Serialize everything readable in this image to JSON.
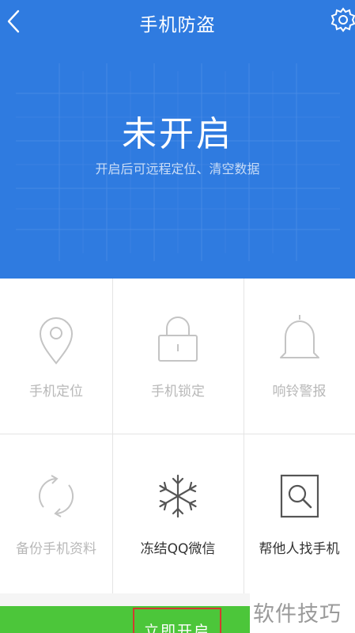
{
  "header": {
    "title": "手机防盗",
    "back_icon": "chevron-left-icon",
    "settings_icon": "gear-icon"
  },
  "status": {
    "text": "未开启",
    "description": "开启后可远程定位、清空数据"
  },
  "features": [
    {
      "label": "手机定位",
      "icon": "location-pin-icon",
      "enabled": false
    },
    {
      "label": "手机锁定",
      "icon": "lock-icon",
      "enabled": false
    },
    {
      "label": "响铃警报",
      "icon": "bell-icon",
      "enabled": false
    },
    {
      "label": "备份手机资料",
      "icon": "sync-icon",
      "enabled": false
    },
    {
      "label": "冻结QQ微信",
      "icon": "snowflake-icon",
      "enabled": true
    },
    {
      "label": "帮他人找手机",
      "icon": "search-frame-icon",
      "enabled": true
    }
  ],
  "action": {
    "open_label": "立即开启"
  },
  "watermark": {
    "text": "软件技巧"
  },
  "colors": {
    "header_blue": "#2f7be0",
    "button_green": "#4cc63a",
    "highlight_red": "#d23b2f",
    "disabled_gray": "#b8b8b8",
    "active_text": "#333333"
  }
}
